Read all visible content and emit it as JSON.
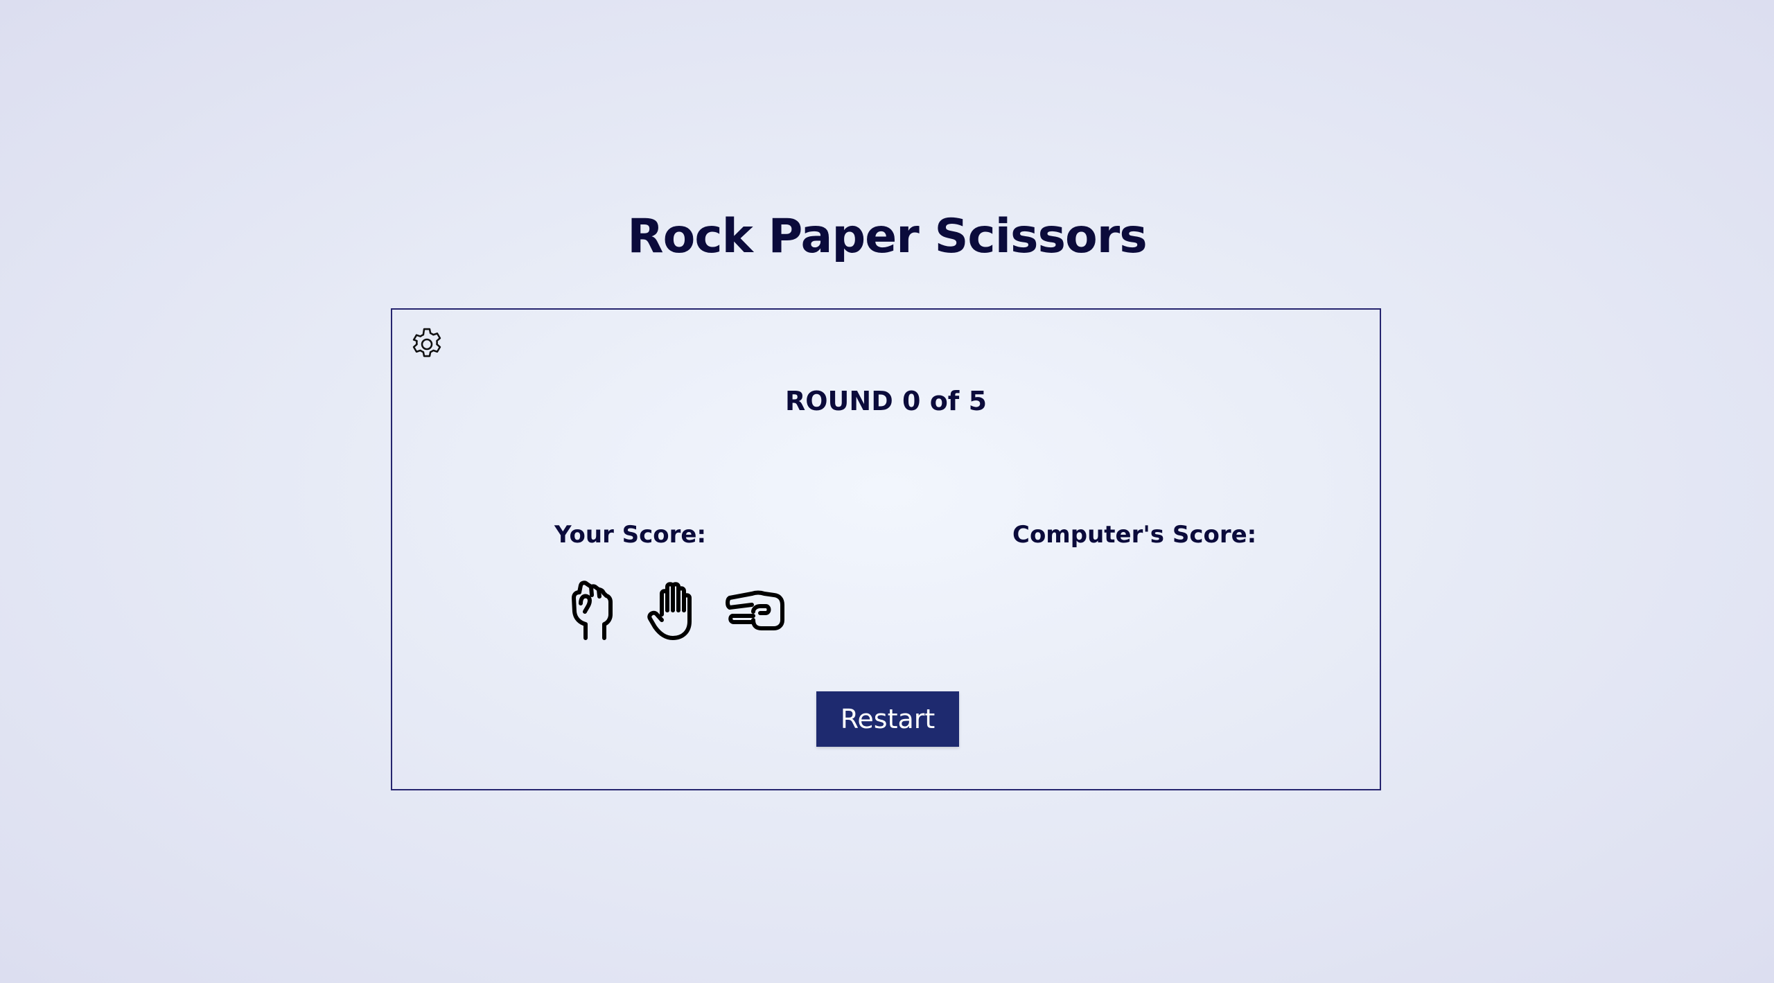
{
  "app": {
    "title": "Rock Paper Scissors"
  },
  "round": {
    "prefix": "ROUND",
    "current": "0",
    "separator": "of",
    "total": "5"
  },
  "scores": {
    "player_label": "Your Score:",
    "computer_label": "Computer's Score:"
  },
  "choices": [
    {
      "name": "rock",
      "icon": "rock-fist-icon"
    },
    {
      "name": "paper",
      "icon": "paper-hand-icon"
    },
    {
      "name": "scissors",
      "icon": "scissors-hand-icon"
    }
  ],
  "controls": {
    "settings_icon": "gear-icon",
    "restart_label": "Restart"
  },
  "colors": {
    "text": "#0b0b3b",
    "panel_border": "#25246e",
    "button_bg": "#1e2a6f",
    "button_text": "#ffffff"
  }
}
